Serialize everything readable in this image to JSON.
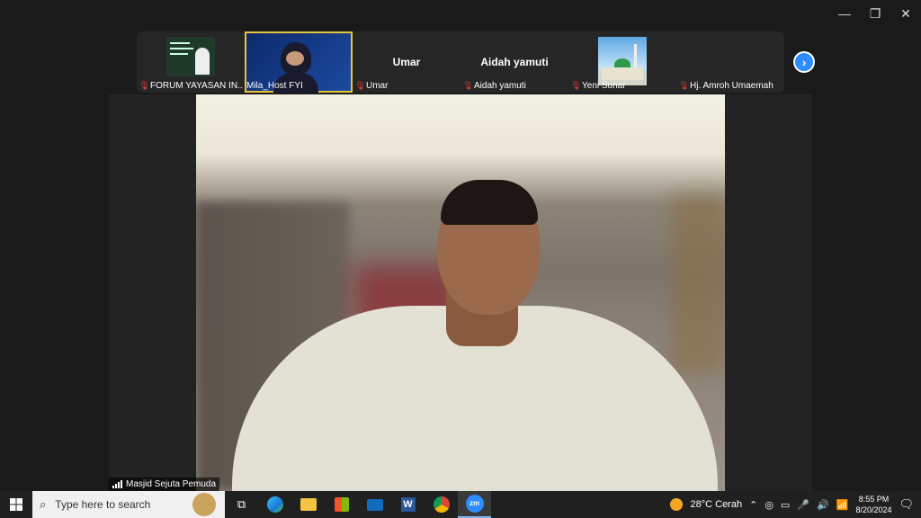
{
  "window": {
    "minimize": "—",
    "restore": "❐",
    "close": "✕"
  },
  "participants": [
    {
      "name": "FORUM YAYASAN IN...",
      "mic_muted": true,
      "has_video": true
    },
    {
      "name": "Mila_Host FYI",
      "mic_muted": false,
      "has_video": true
    },
    {
      "name": "Umar",
      "mic_muted": true,
      "has_video": false
    },
    {
      "name": "Aidah yamuti",
      "mic_muted": true,
      "has_video": false
    },
    {
      "name": "Yeni Sunar",
      "mic_muted": true,
      "has_video": true
    },
    {
      "name": "Hj. Amroh Umaemah",
      "mic_muted": true,
      "has_video": false
    }
  ],
  "next_page_icon": "chevron-right-icon",
  "speaker": {
    "name": "Masjid Sejuta Pemuda"
  },
  "taskbar": {
    "search_placeholder": "Type here to search",
    "weather": "28°C  Cerah",
    "time": "8:55 PM",
    "date": "8/20/2024",
    "accent": "#2d8cff"
  }
}
